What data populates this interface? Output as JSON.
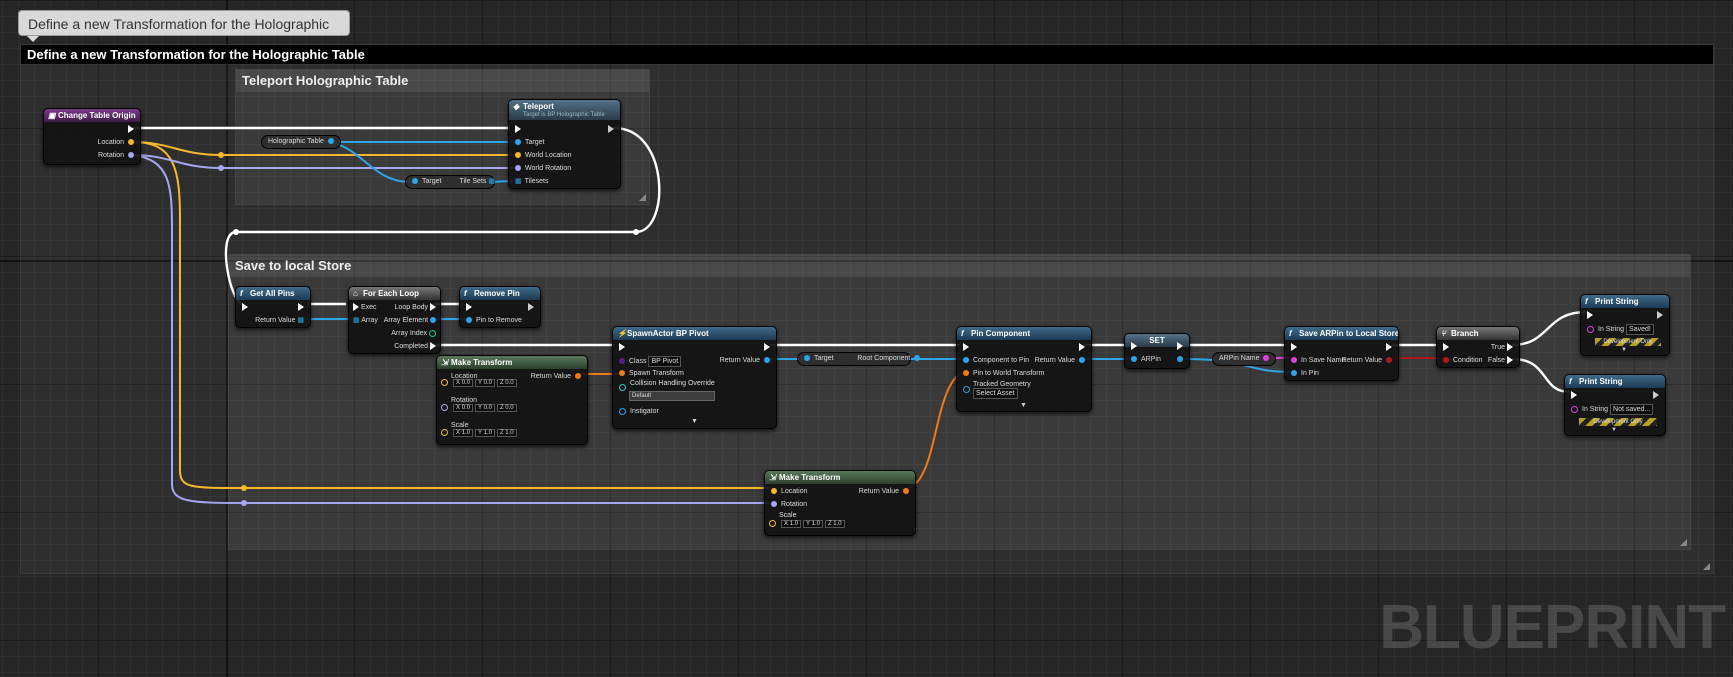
{
  "tooltip": "Define a new Transformation for the Holographic Table",
  "main_comment": "Define a new Transformation for the Holographic Table",
  "comments": {
    "teleport": "Teleport Holographic Table",
    "save": "Save to local Store"
  },
  "watermark": "BLUEPRINT",
  "nodes": {
    "change_table_origin": {
      "title": "Change Table Origin",
      "location": "Location",
      "rotation": "Rotation"
    },
    "teleport": {
      "title": "Teleport",
      "subtitle": "Target is BP Holographic Table",
      "target": "Target",
      "world_location": "World Location",
      "world_rotation": "World Rotation",
      "tilesets": "Tilesets"
    },
    "holographic_table": {
      "label": "Holographic Table"
    },
    "tile_sets": {
      "target": "Target",
      "tile_sets": "Tile Sets"
    },
    "get_all_pins": {
      "title": "Get All Pins",
      "return_value": "Return Value"
    },
    "for_each_loop": {
      "title": "For Each Loop",
      "exec": "Exec",
      "array": "Array",
      "loop_body": "Loop Body",
      "array_element": "Array Element",
      "array_index": "Array Index",
      "completed": "Completed"
    },
    "remove_pin": {
      "title": "Remove Pin",
      "pin_to_remove": "Pin to Remove"
    },
    "make_transform_1": {
      "title": "Make Transform",
      "location": "Location",
      "rotation": "Rotation",
      "scale": "Scale",
      "return_value": "Return Value",
      "loc": [
        "X",
        "0.0",
        "Y",
        "0.0",
        "Z",
        "0.0"
      ],
      "rot": [
        "X",
        "0.0",
        "Y",
        "0.0",
        "Z",
        "0.0"
      ],
      "scl": [
        "X",
        "1.0",
        "Y",
        "1.0",
        "Z",
        "1.0"
      ]
    },
    "spawn_actor": {
      "title": "SpawnActor BP Pivot",
      "class": "Class",
      "class_value": "BP Pivot",
      "spawn_transform": "Spawn Transform",
      "collision": "Collision Handling Override",
      "collision_value": "Default",
      "instigator": "Instigator",
      "return_value": "Return Value"
    },
    "root_component": {
      "target": "Target",
      "root_component": "Root Component"
    },
    "make_transform_2": {
      "title": "Make Transform",
      "location": "Location",
      "rotation": "Rotation",
      "scale": "Scale",
      "return_value": "Return Value",
      "scl": [
        "X",
        "1.0",
        "Y",
        "1.0",
        "Z",
        "1.0"
      ]
    },
    "pin_component": {
      "title": "Pin Component",
      "component_to_pin": "Component to Pin",
      "pin_world_transform": "Pin to World Transform",
      "tracked_geometry": "Tracked Geometry",
      "tracked_value": "Select Asset",
      "return_value": "Return Value"
    },
    "set": {
      "title": "SET",
      "ar_pin": "ARPin"
    },
    "ar_pin_name": {
      "label": "ARPin Name"
    },
    "save_ar_pin": {
      "title": "Save ARPin to Local Store",
      "in_save_name": "In Save Name",
      "in_pin": "In Pin",
      "return_value": "Return Value"
    },
    "branch": {
      "title": "Branch",
      "condition": "Condition",
      "true_label": "True",
      "false_label": "False"
    },
    "print_string_1": {
      "title": "Print String",
      "in_string": "In String",
      "value": "Saved!",
      "dev": "Development Only"
    },
    "print_string_2": {
      "title": "Print String",
      "in_string": "In String",
      "value": "Not saved...",
      "dev": "Development Only"
    }
  },
  "colors": {
    "exec": "#ffffff",
    "vector": "#f5b82c",
    "rotator": "#a6a6f0",
    "object": "#2ea4e8",
    "transform": "#f07b18",
    "string": "#e040e0",
    "bool": "#b01818"
  }
}
